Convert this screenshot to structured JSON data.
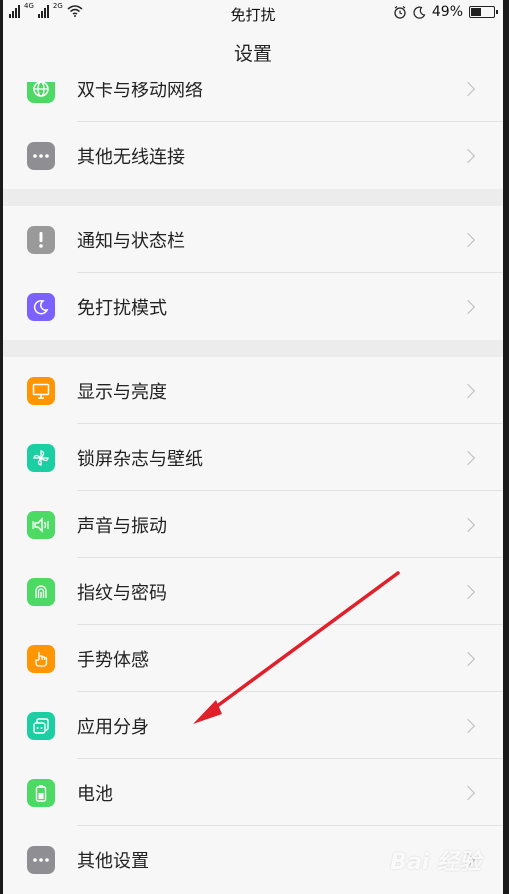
{
  "status_bar": {
    "signal_1_label": "4G",
    "signal_2_label": "2G",
    "center_text": "免打扰",
    "battery_text": "49%",
    "battery_level": 0.49
  },
  "nav": {
    "title": "设置"
  },
  "groups": [
    {
      "items": [
        {
          "label": "双卡与移动网络",
          "icon": "globe-icon",
          "color": "#4cd964"
        },
        {
          "label": "其他无线连接",
          "icon": "more-dots-icon",
          "color": "#8e8e93"
        }
      ]
    },
    {
      "items": [
        {
          "label": "通知与状态栏",
          "icon": "exclamation-icon",
          "color": "#9a9a9a"
        },
        {
          "label": "免打扰模式",
          "icon": "moon-icon",
          "color": "#7b61ff"
        }
      ]
    },
    {
      "items": [
        {
          "label": "显示与亮度",
          "icon": "monitor-icon",
          "color": "#ff9500"
        },
        {
          "label": "锁屏杂志与壁纸",
          "icon": "pinwheel-icon",
          "color": "#1ccfa3"
        },
        {
          "label": "声音与振动",
          "icon": "speaker-icon",
          "color": "#4cd964"
        },
        {
          "label": "指纹与密码",
          "icon": "fingerprint-icon",
          "color": "#4cd964"
        },
        {
          "label": "手势体感",
          "icon": "hand-gesture-icon",
          "color": "#ff9500"
        },
        {
          "label": "应用分身",
          "icon": "app-clone-icon",
          "color": "#1ccfa3"
        },
        {
          "label": "电池",
          "icon": "battery-icon",
          "color": "#4cd964"
        },
        {
          "label": "其他设置",
          "icon": "more-dots-icon",
          "color": "#8e8e93"
        }
      ]
    }
  ],
  "annotation": {
    "arrow_color": "#e0202a"
  },
  "watermark": {
    "text": "Bai 经验"
  }
}
